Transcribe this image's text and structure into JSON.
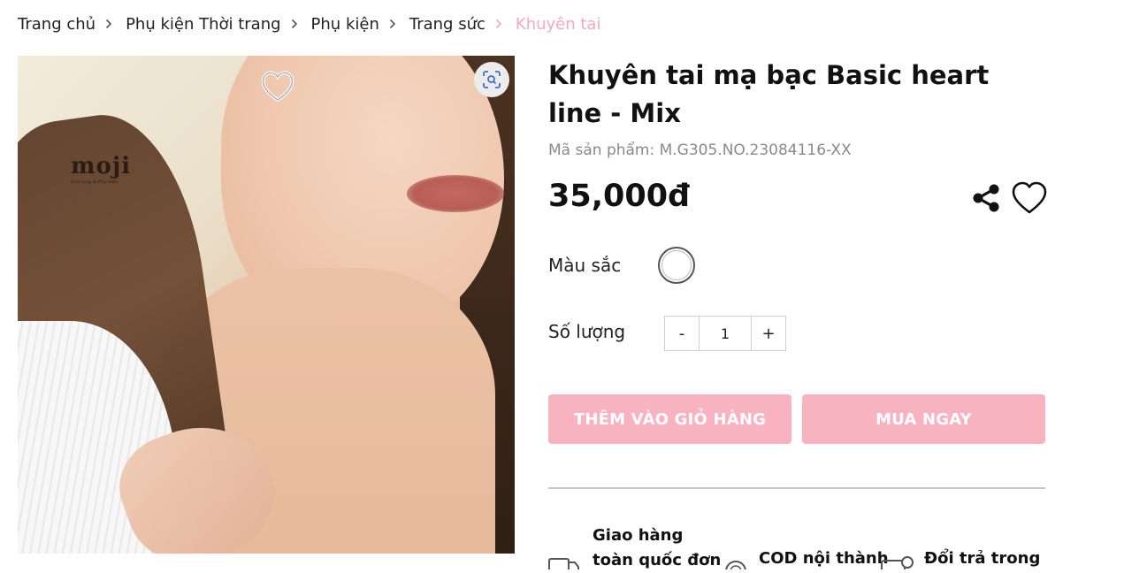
{
  "breadcrumb": {
    "items": [
      "Trang chủ",
      "Phụ kiện Thời trang",
      "Phụ kiện",
      "Trang sức"
    ],
    "current": "Khuyên tai"
  },
  "product": {
    "image": {
      "watermark_logo": "moji",
      "watermark_tagline": "Quà tặng & Phụ kiện"
    },
    "title": "Khuyên tai mạ bạc Basic heart line - Mix",
    "sku": "Mã sản phẩm: M.G305.NO.23084116-XX",
    "price": "35,000đ",
    "color_label": "Màu sắc",
    "color_swatch": "#ffffff",
    "quantity_label": "Số lượng",
    "quantity_value": "1",
    "decrement_label": "-",
    "increment_label": "+",
    "add_to_cart_label": "THÊM VÀO GIỎ HÀNG",
    "buy_now_label": "MUA NGAY"
  },
  "features": [
    {
      "text": "Giao hàng toàn quốc đơn",
      "icon": "truck-icon"
    },
    {
      "text": "COD nội thành",
      "icon": "cod-icon"
    },
    {
      "text": "Đổi trả trong",
      "icon": "return-icon"
    }
  ],
  "colors": {
    "accent_button": "#f9b2c0",
    "breadcrumb_current": "#f7a8b8",
    "text": "#111111",
    "muted": "#8a8a8a"
  }
}
